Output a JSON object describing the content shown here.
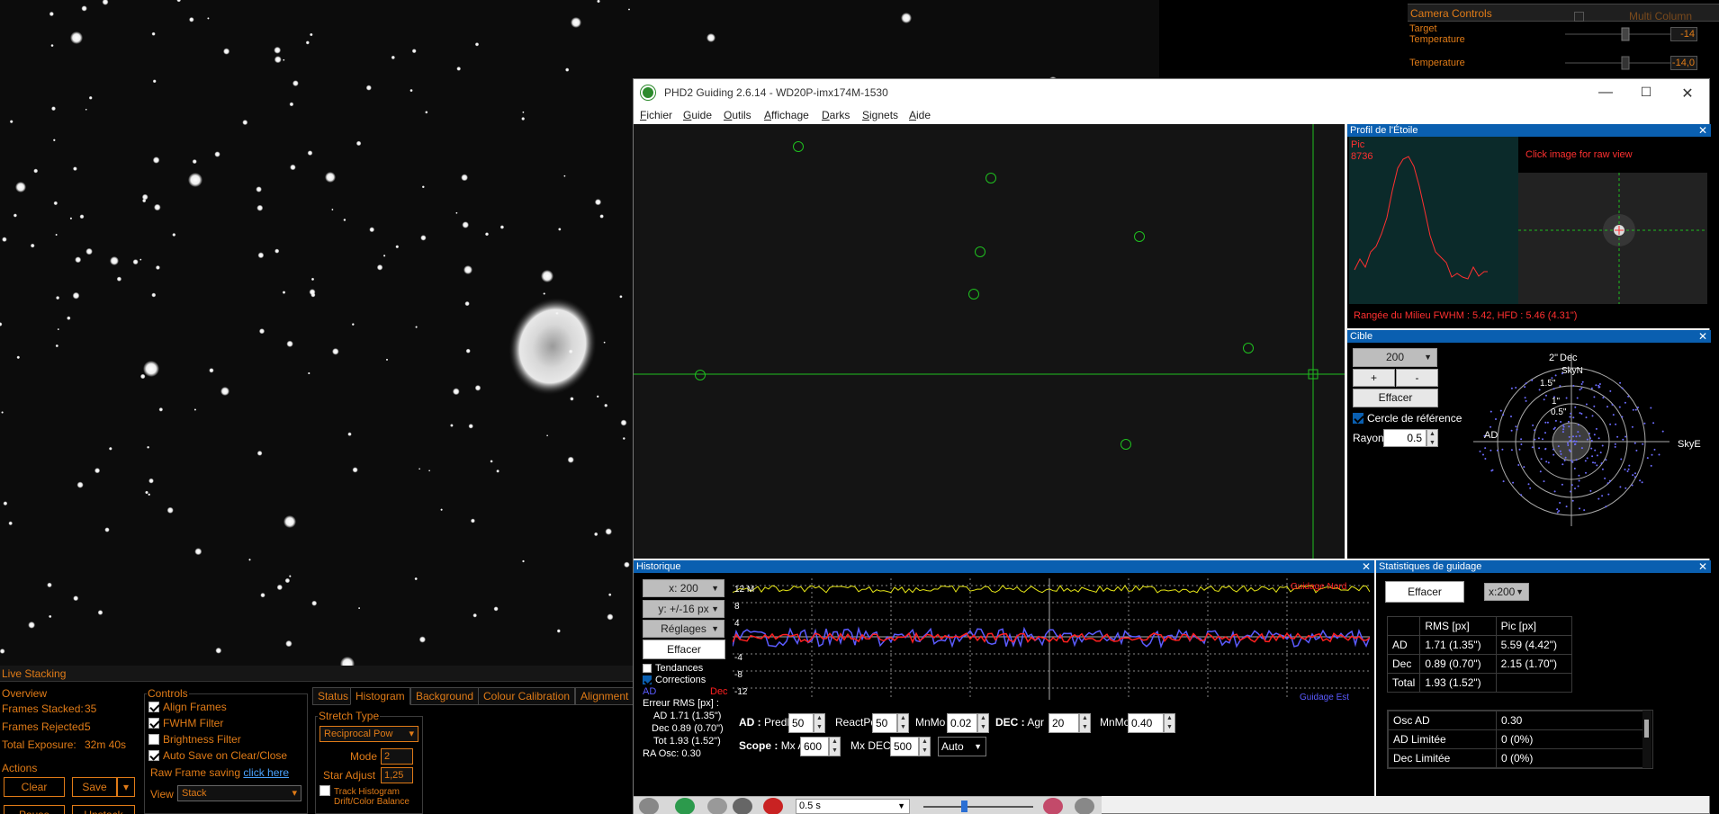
{
  "camera_controls": {
    "title": "Camera Controls",
    "multi_column": "Multi Column",
    "target_temp_label": "Target Temperature",
    "target_temp_value": "-14",
    "temp_label": "Temperature",
    "temp_value": "-14,0"
  },
  "live_stacking": {
    "title": "Live Stacking",
    "overview": {
      "title": "Overview",
      "frames_stacked_label": "Frames Stacked:",
      "frames_stacked": "35",
      "frames_rejected_label": "Frames Rejected:",
      "frames_rejected": "5",
      "total_exposure_label": "Total Exposure:",
      "total_exposure": "32m 40s"
    },
    "actions": {
      "title": "Actions",
      "clear": "Clear",
      "save": "Save",
      "pause": "Pause",
      "unstack": "Unstack"
    },
    "controls": {
      "title": "Controls",
      "align_frames": "Align Frames",
      "fwhm_filter": "FWHM Filter",
      "brightness_filter": "Brightness Filter",
      "auto_save": "Auto Save on Clear/Close",
      "raw_frame_saving": "Raw Frame saving",
      "click_here": "click here",
      "view_label": "View",
      "view_value": "Stack"
    },
    "tabs": [
      "Status",
      "Histogram",
      "Background",
      "Colour Calibration",
      "Alignment"
    ],
    "stretch": {
      "title": "Stretch Type",
      "type": "Reciprocal Pow",
      "mode_label": "Mode",
      "mode_value": "2",
      "star_adjust_label": "Star Adjust",
      "star_adjust_value": "1,25",
      "track_histogram": "Track Histogram",
      "drift_color": "Drift/Color Balance"
    }
  },
  "phd": {
    "title": "PHD2 Guiding 2.6.14 - WD20P-imx174M-1530",
    "menu": [
      "Fichier",
      "Guide",
      "Outils",
      "Affichage",
      "Darks",
      "Signets",
      "Aide"
    ],
    "profile": {
      "title": "Profil de l'Étoile",
      "pic_label": "Pic",
      "pic_value": "8736",
      "click_hint": "Click image for raw view",
      "footer": "Rangée du Milieu FWHM : 5.42, HFD : 5.46 (4.31\")"
    },
    "target": {
      "title": "Cible",
      "scale": "200",
      "plus": "+",
      "minus": "-",
      "clear": "Effacer",
      "ref_circle": "Cercle de référence",
      "radius_label": "Rayon:",
      "radius_value": "0.5",
      "labels": [
        "2\"",
        "Dec",
        "SkyN",
        "1.5\"",
        "1\"",
        "0.5\"",
        "AD",
        "SkyE"
      ]
    },
    "history": {
      "title": "Historique",
      "x_scale": "x: 200",
      "y_scale": "y: +/-16 px",
      "settings": "Réglages",
      "clear": "Effacer",
      "trends": "Tendances",
      "corrections": "Corrections",
      "ad": "AD",
      "dec": "Dec",
      "rms_title": "Erreur RMS [px] :",
      "rms_ad": "AD  1.71 (1.35\")",
      "rms_dec": "Dec  0.89 (0.70\")",
      "rms_tot": "Tot  1.93 (1.52\")",
      "ra_osc": "RA Osc: 0.30",
      "y_ticks": [
        "12",
        "8",
        "4",
        "-4",
        "-8",
        "-12"
      ],
      "y_ticks_top_label": "12 M",
      "legend_west": "Guidage Est",
      "legend_top_right": "Guidage Nord"
    },
    "params": {
      "ad_label": "AD :",
      "predpd_label": "PredPd",
      "predpd": "50",
      "reactpd_label": "ReactPd",
      "reactpd": "50",
      "mnmo1_label": "MnMo",
      "mnmo1": "0.02",
      "dec_label": "DEC :",
      "agr_label": "Agr",
      "agr": "20",
      "mnmo2_label": "MnMo",
      "mnmo2": "0.40",
      "scope_label": "Scope :",
      "mxad_label": "Mx AD",
      "mxad": "600",
      "mxdec_label": "Mx DEC",
      "mxdec": "500",
      "auto": "Auto"
    },
    "stats": {
      "title": "Statistiques de guidage",
      "clear": "Effacer",
      "scale": "x:200",
      "header": [
        "",
        "RMS [px]",
        "Pic [px]"
      ],
      "rows": [
        [
          "AD",
          "1.71 (1.35\")",
          "5.59 (4.42\")"
        ],
        [
          "Dec",
          "0.89 (0.70\")",
          "2.15 (1.70\")"
        ],
        [
          "Total",
          "1.93 (1.52\")",
          ""
        ]
      ],
      "osc": [
        [
          "Osc AD",
          "0.30"
        ],
        [
          "AD Limitée",
          "0 (0%)"
        ],
        [
          "Dec Limitée",
          "0 (0%)"
        ]
      ]
    },
    "exposure": "0.5 s"
  },
  "colors": {
    "orange": "#e07b17",
    "title_blue": "#0a5fb0",
    "guide_green": "#1fbf1f",
    "ra_blue": "#5b5bff",
    "dec_red": "#ff2020"
  }
}
